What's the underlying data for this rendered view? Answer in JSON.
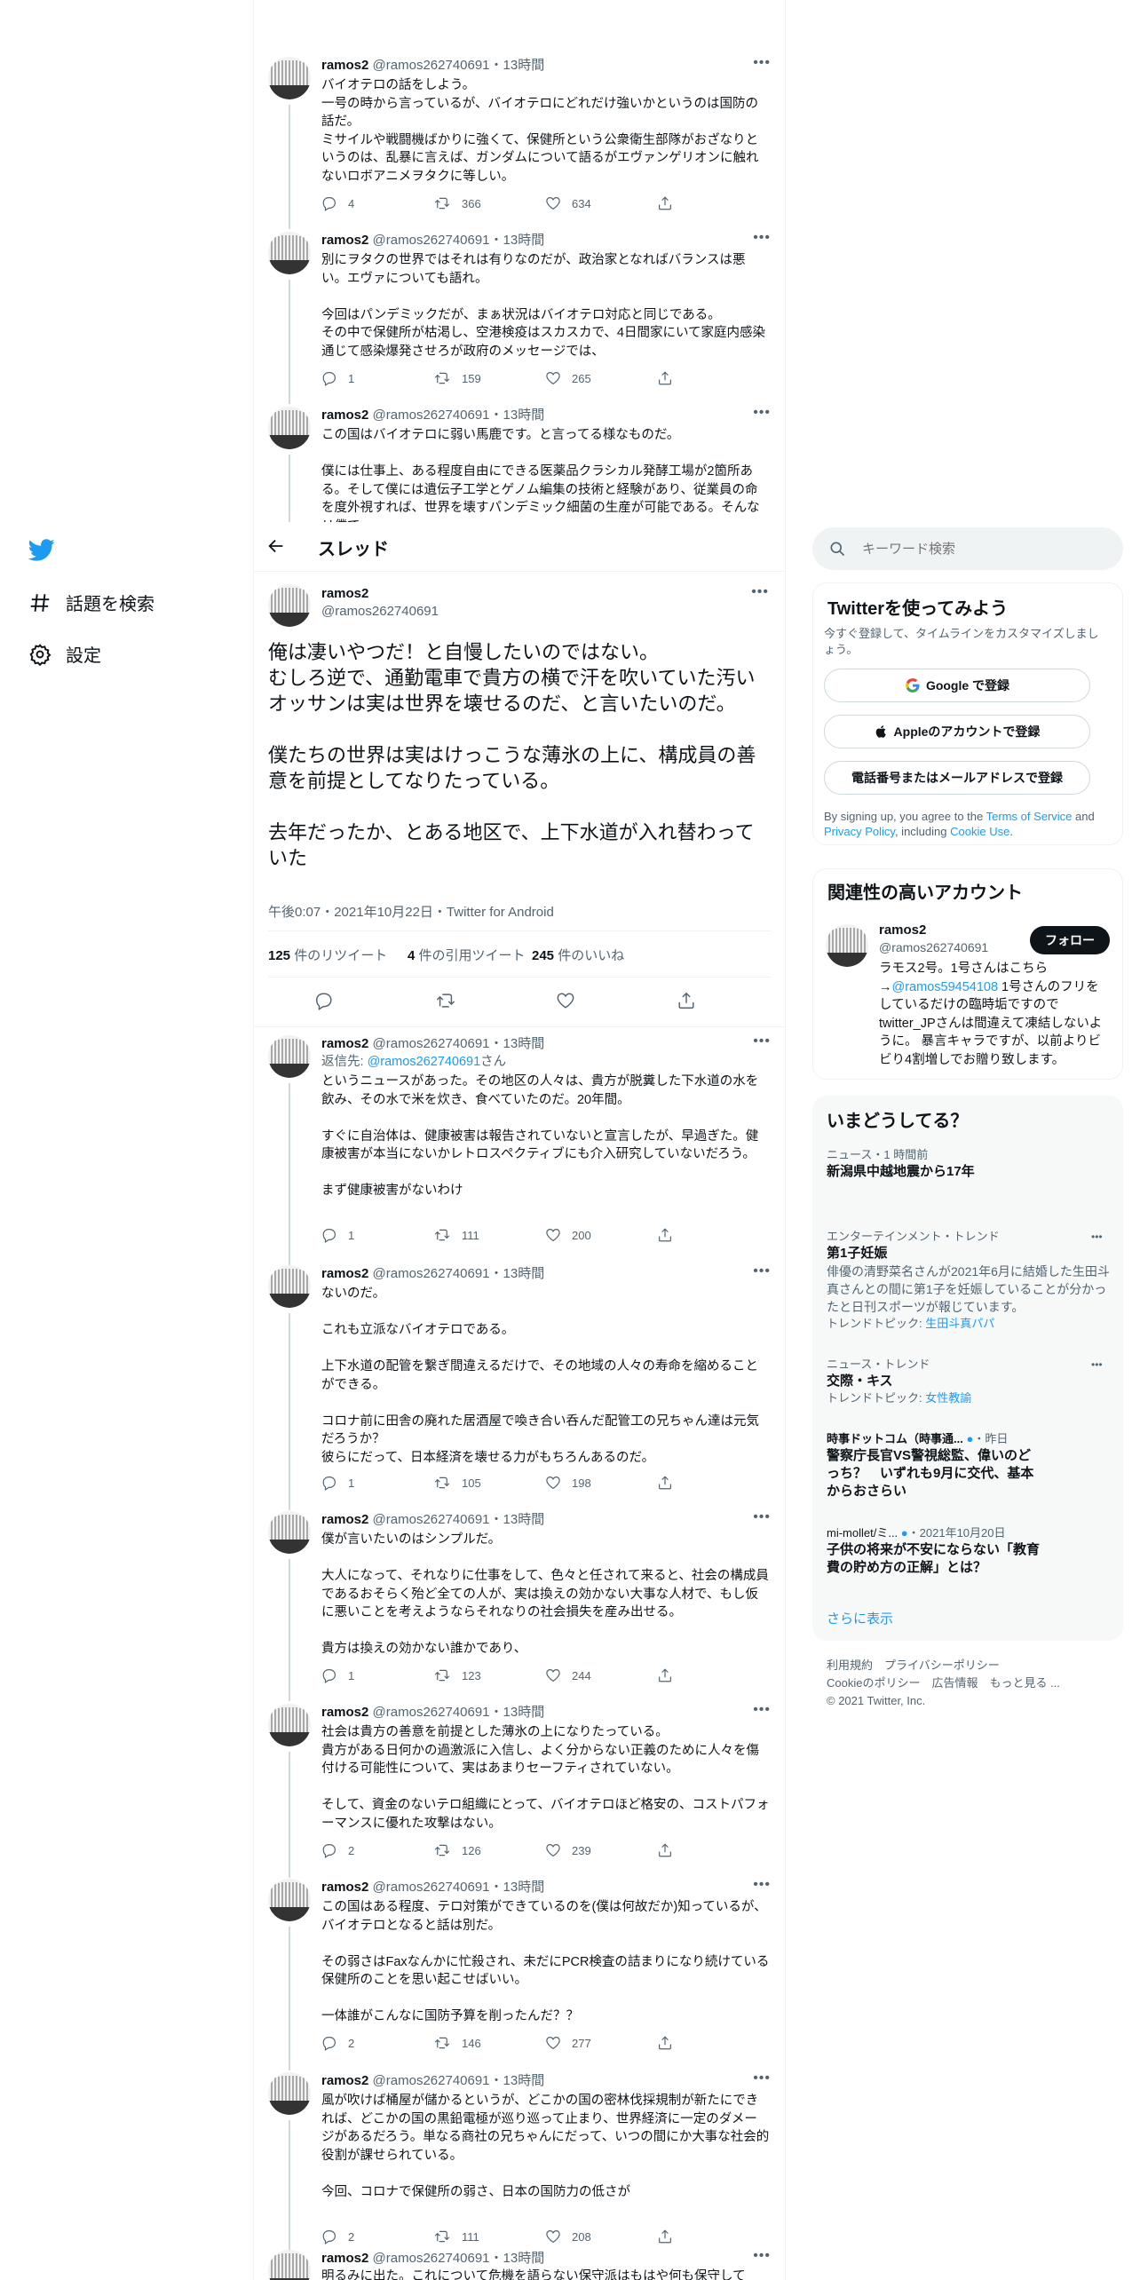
{
  "colors": {
    "accent": "#1d9bf0",
    "text": "#0f1419",
    "secondary": "#536471",
    "border": "#eff3f4"
  },
  "nav": {
    "logo_icon": "twitter-bird-icon",
    "items": [
      {
        "icon": "hashtag-icon",
        "label": "話題を検索"
      },
      {
        "icon": "gear-icon",
        "label": "設定"
      }
    ]
  },
  "header": {
    "back_icon": "arrow-left-icon",
    "title": "スレッド"
  },
  "above_tweets": [
    {
      "name": "ramos2",
      "handle": "@ramos262740691",
      "time": "13時間",
      "text": "バイオテロの話をしよう。\n一号の時から言っているが、バイオテロにどれだけ強いかというのは国防の話だ。\nミサイルや戦闘機ばかりに強くて、保健所という公衆衛生部隊がおざなりというのは、乱暴に言えば、ガンダムについて語るがエヴァンゲリオンに触れないロボアニメヲタクに等しい。",
      "replies": "4",
      "retweets": "366",
      "likes": "634"
    },
    {
      "name": "ramos2",
      "handle": "@ramos262740691",
      "time": "13時間",
      "text": "別にヲタクの世界ではそれは有りなのだが、政治家となればバランスは悪い。エヴァについても語れ。\n\n今回はパンデミックだが、まぁ状況はバイオテロ対応と同じである。\nその中で保健所が枯渇し、空港検疫はスカスカで、4日間家にいて家庭内感染通じて感染爆発させろが政府のメッセージでは、",
      "replies": "1",
      "retweets": "159",
      "likes": "265"
    },
    {
      "name": "ramos2",
      "handle": "@ramos262740691",
      "time": "13時間",
      "text": "この国はバイオテロに弱い馬鹿です。と言ってる様なものだ。\n\n僕には仕事上、ある程度自由にできる医薬品クラシカル発酵工場が2箇所ある。そして僕には遺伝子工学とゲノム編集の技術と経験があり、従業員の命を度外視すれば、世界を壊すパンデミック細菌の生産が可能である。そんなリ僕で",
      "replies": "",
      "retweets": "",
      "likes": ""
    }
  ],
  "main_tweet": {
    "name": "ramos2",
    "handle": "@ramos262740691",
    "text": "俺は凄いやつだ！と自慢したいのではない。\nむしろ逆で、通勤電車で貴方の横で汗を吹いていた汚いオッサンは実は世界を壊せるのだ、と言いたいのだ。\n\n僕たちの世界は実はけっこうな薄氷の上に、構成員の善意を前提としてなりたっている。\n\n去年だったか、とある地区で、上下水道が入れ替わっていた",
    "meta": "午後0:07・2021年10月22日・Twitter for Android",
    "stats": {
      "retweets_num": "125",
      "retweets_label": "件のリツイート",
      "quotes_num": "4",
      "quotes_label": "件の引用ツイート",
      "likes_num": "245",
      "likes_label": "件のいいね"
    }
  },
  "reply_tweets": [
    {
      "name": "ramos2",
      "handle": "@ramos262740691",
      "time": "13時間",
      "reply_prefix": "返信先: ",
      "reply_to": "@ramos262740691",
      "reply_suffix": "さん",
      "text": "というニュースがあった。その地区の人々は、貴方が脱糞した下水道の水を飲み、その水で米を炊き、食べていたのだ。20年間。\n\nすぐに自治体は、健康被害は報告されていないと宣言したが、早過ぎた。健康被害が本当にないかレトロスペクティブにも介入研究していないだろう。\n\nまず健康被害がないわけ",
      "replies": "1",
      "retweets": "111",
      "likes": "200"
    },
    {
      "name": "ramos2",
      "handle": "@ramos262740691",
      "time": "13時間",
      "text": "ないのだ。\n\nこれも立派なバイオテロである。\n\n上下水道の配管を繋ぎ間違えるだけで、その地域の人々の寿命を縮めることができる。\n\nコロナ前に田舎の廃れた居酒屋で喚き合い呑んだ配管工の兄ちゃん達は元気だろうか？\n彼らにだって、日本経済を壊せる力がもちろんあるのだ。",
      "replies": "1",
      "retweets": "105",
      "likes": "198"
    },
    {
      "name": "ramos2",
      "handle": "@ramos262740691",
      "time": "13時間",
      "text": "僕が言いたいのはシンプルだ。\n\n大人になって、それなりに仕事をして、色々と任されて来ると、社会の構成員であるおそらく殆ど全ての人が、実は換えの効かない大事な人材で、もし仮に悪いことを考えようならそれなりの社会損失を産み出せる。\n\n貴方は換えの効かない誰かであり、",
      "replies": "1",
      "retweets": "123",
      "likes": "244"
    },
    {
      "name": "ramos2",
      "handle": "@ramos262740691",
      "time": "13時間",
      "text": "社会は貴方の善意を前提とした薄氷の上になりたっている。\n貴方がある日何かの過激派に入信し、よく分からない正義のために人々を傷付ける可能性について、実はあまりセーフティされていない。\n\nそして、資金のないテロ組織にとって、バイオテロほど格安の、コストパフォーマンスに優れた攻撃はない。",
      "replies": "2",
      "retweets": "126",
      "likes": "239"
    },
    {
      "name": "ramos2",
      "handle": "@ramos262740691",
      "time": "13時間",
      "text": "この国はある程度、テロ対策ができているのを(僕は何故だか)知っているが、バイオテロとなると話は別だ。\n\nその弱さはFaxなんかに忙殺され、未だにPCR検査の詰まりになり続けている保健所のことを思い起こせばいい。\n\n一体誰がこんなに国防予算を削ったんだ？？",
      "replies": "2",
      "retweets": "146",
      "likes": "277"
    },
    {
      "name": "ramos2",
      "handle": "@ramos262740691",
      "time": "13時間",
      "text": "風が吹けば桶屋が儲かるというが、どこかの国の密林伐採規制が新たにできれば、どこかの国の黒鉛電極が巡り巡って止まり、世界経済に一定のダメージがあるだろう。単なる商社の兄ちゃんにだって、いつの間にか大事な社会的役割が課せられている。\n\n今回、コロナで保健所の弱さ、日本の国防力の低さが",
      "replies": "2",
      "retweets": "111",
      "likes": "208"
    },
    {
      "name": "ramos2",
      "handle": "@ramos262740691",
      "time": "13時間",
      "text": "明るみに出た。これについて危機を語らない保守派はもはや何も保守して",
      "replies": "",
      "retweets": "",
      "likes": ""
    }
  ],
  "search": {
    "placeholder": "キーワード検索"
  },
  "signup": {
    "title": "Twitterを使ってみよう",
    "subtitle": "今すぐ登録して、タイムラインをカスタマイズしましょう。",
    "google": "Google で登録",
    "apple": "Appleのアカウントで登録",
    "phone": "電話番号またはメールアドレスで登録",
    "terms_pre": "By signing up, you agree to the ",
    "terms_link": "Terms of Service",
    "terms_and": " and ",
    "privacy_link": "Privacy Policy",
    "terms_mid": ", including ",
    "cookie_link": "Cookie Use",
    "terms_end": "."
  },
  "related": {
    "title": "関連性の高いアカウント",
    "name": "ramos2",
    "handle": "@ramos262740691",
    "follow": "フォロー",
    "bio_pre": "ラモス2号。1号さんはこちら→",
    "bio_link": "@ramos59454108",
    "bio_post": " 1号さんのフリをしているだけの臨時垢ですので twitter_JPさんは間違えて凍結しないように。 暴言キャラですが、以前よりビビり4割増しでお贈り致します。"
  },
  "trends": {
    "title": "いまどうしてる？",
    "items": [
      {
        "meta": "ニュース・1 時間前",
        "title": "新潟県中越地震から17年",
        "desc": "",
        "topic_label": "",
        "topic": ""
      },
      {
        "meta": "エンターテインメント・トレンド",
        "title": "第1子妊娠",
        "desc": "俳優の清野菜名さんが2021年6月に結婚した生田斗真さんとの間に第1子を妊娠していることが分かったと日刊スポーツが報じています。",
        "topic_label": "トレンドトピック: ",
        "topic": "生田斗真パパ"
      },
      {
        "meta": "ニュース・トレンド",
        "title": "交際・キス",
        "desc": "",
        "topic_label": "トレンドトピック: ",
        "topic": "女性教諭"
      },
      {
        "source": "時事ドットコム（時事通...",
        "when": "・昨日",
        "title": "警察庁長官VS警視総監、偉いのどっち？　いずれも9月に交代、基本からおさらい"
      },
      {
        "source": "mi-mollet/ミ...",
        "when": "・2021年10月20日",
        "title": "子供の将来が不安にならない「教育費の貯め方の正解」とは？"
      }
    ],
    "more": "さらに表示"
  },
  "footer": {
    "line1": "利用規約　プライバシーポリシー",
    "line2": "Cookieのポリシー　広告情報　もっと見る ...",
    "line3": "© 2021 Twitter, Inc."
  }
}
